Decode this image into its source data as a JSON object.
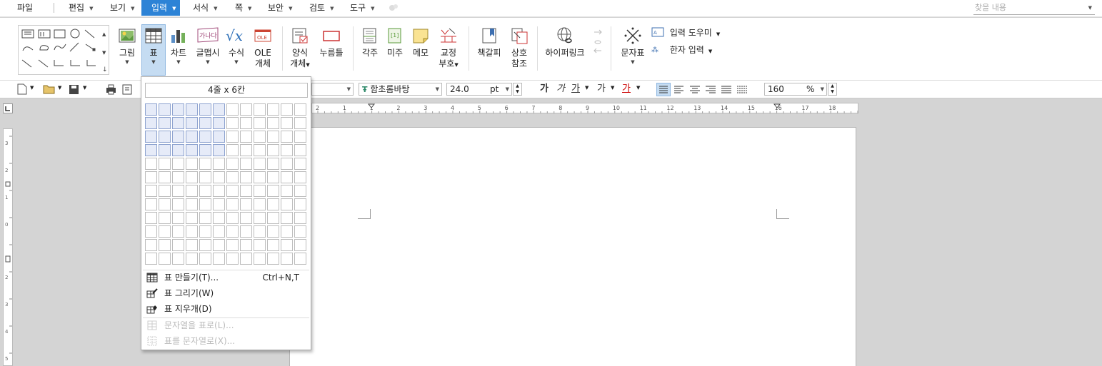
{
  "menubar": {
    "items": [
      {
        "label": "파일"
      },
      {
        "label": "편집"
      },
      {
        "label": "보기"
      },
      {
        "label": "입력",
        "active": true
      },
      {
        "label": "서식"
      },
      {
        "label": "쪽"
      },
      {
        "label": "보안"
      },
      {
        "label": "검토"
      },
      {
        "label": "도구"
      }
    ],
    "search_placeholder": "찾을 내용"
  },
  "ribbon": {
    "picture": "그림",
    "table": "표",
    "chart": "차트",
    "wordart": "글맵시",
    "equation": "수식",
    "ole_line1": "OLE",
    "ole_line2": "개체",
    "form_line1": "양식",
    "form_line2": "개체",
    "pushbutton": "누름틀",
    "footnote": "각주",
    "endnote": "미주",
    "memo": "메모",
    "proof_line1": "교정",
    "proof_line2": "부호",
    "bookmark": "책갈피",
    "crossref_line1": "상호",
    "crossref_line2": "참조",
    "hyperlink": "하이퍼링크",
    "symbol": "문자표",
    "input_helper": "입력 도우미",
    "hanja_input": "한자 입력",
    "ole_icon_text": "OLE",
    "wordart_icon_text": "가나다"
  },
  "formatbar": {
    "font": "함초롬바탕",
    "size": "24.0",
    "size_unit": "pt",
    "bold": "가",
    "italic": "가",
    "underline": "가",
    "strike": "가",
    "fontcolor": "가",
    "zoom": "160",
    "zoom_unit": "%"
  },
  "table_dropdown": {
    "grid_label": "4줄 x 6칸",
    "rows_selected": 4,
    "cols_selected": 6,
    "grid_rows": 12,
    "grid_cols": 12,
    "items": [
      {
        "label": "표 만들기(T)...",
        "shortcut": "Ctrl+N,T",
        "enabled": true
      },
      {
        "label": "표 그리기(W)",
        "shortcut": "",
        "enabled": true
      },
      {
        "label": "표 지우개(D)",
        "shortcut": "",
        "enabled": true
      },
      {
        "label": "문자열을 표로(L)...",
        "shortcut": "",
        "enabled": false
      },
      {
        "label": "표를 문자열로(X)...",
        "shortcut": "",
        "enabled": false
      }
    ]
  },
  "ruler": {
    "labels": [
      "2",
      "1",
      "1",
      "2",
      "3",
      "4",
      "5",
      "6",
      "7",
      "8",
      "9",
      "10",
      "11",
      "12",
      "13",
      "14",
      "15",
      "16",
      "17",
      "18"
    ]
  },
  "colors": {
    "accent": "#2d83d6",
    "selected_cell": "#e6ebf8"
  }
}
